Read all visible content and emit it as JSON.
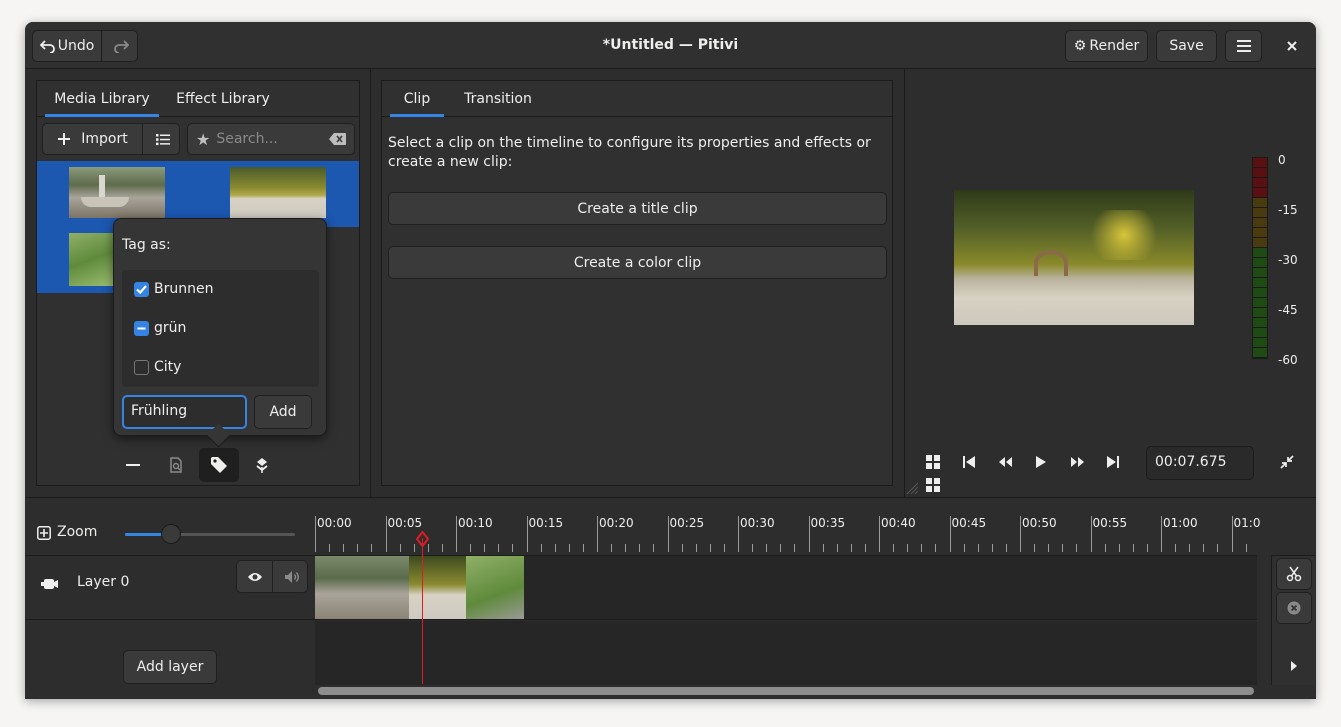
{
  "window": {
    "title": "*Untitled — Pitivi",
    "undo_label": "Undo",
    "render_label": "Render",
    "save_label": "Save"
  },
  "media_panel": {
    "tabs": [
      "Media Library",
      "Effect Library"
    ],
    "import_label": "Import",
    "search_placeholder": "Search..."
  },
  "tag_popover": {
    "heading": "Tag as:",
    "tags": [
      {
        "label": "Brunnen",
        "state": "checked"
      },
      {
        "label": "grün",
        "state": "mixed"
      },
      {
        "label": "City",
        "state": "unchecked"
      }
    ],
    "input_value": "Frühling",
    "add_label": "Add"
  },
  "clip_panel": {
    "tabs": [
      "Clip",
      "Transition"
    ],
    "description": "Select a clip on the timeline to configure its properties and effects or create a new clip:",
    "create_title_label": "Create a title clip",
    "create_color_label": "Create a color clip"
  },
  "viewer": {
    "timecode": "00:07.675",
    "vu_labels": [
      "0",
      "-15",
      "-30",
      "-45",
      "-60"
    ]
  },
  "timeline": {
    "zoom_label": "Zoom",
    "zoom_level": 0.27,
    "ruler_labels": [
      "00:00",
      "00:05",
      "00:10",
      "00:15",
      "00:20",
      "00:25",
      "00:30",
      "00:35",
      "00:40",
      "00:45",
      "00:50",
      "00:55",
      "01:00",
      "01:0"
    ],
    "layer_name": "Layer 0",
    "add_layer_label": "Add layer"
  },
  "colors": {
    "accent": "#3584e4",
    "selection": "#1c57b0",
    "playhead": "#e01b24"
  }
}
